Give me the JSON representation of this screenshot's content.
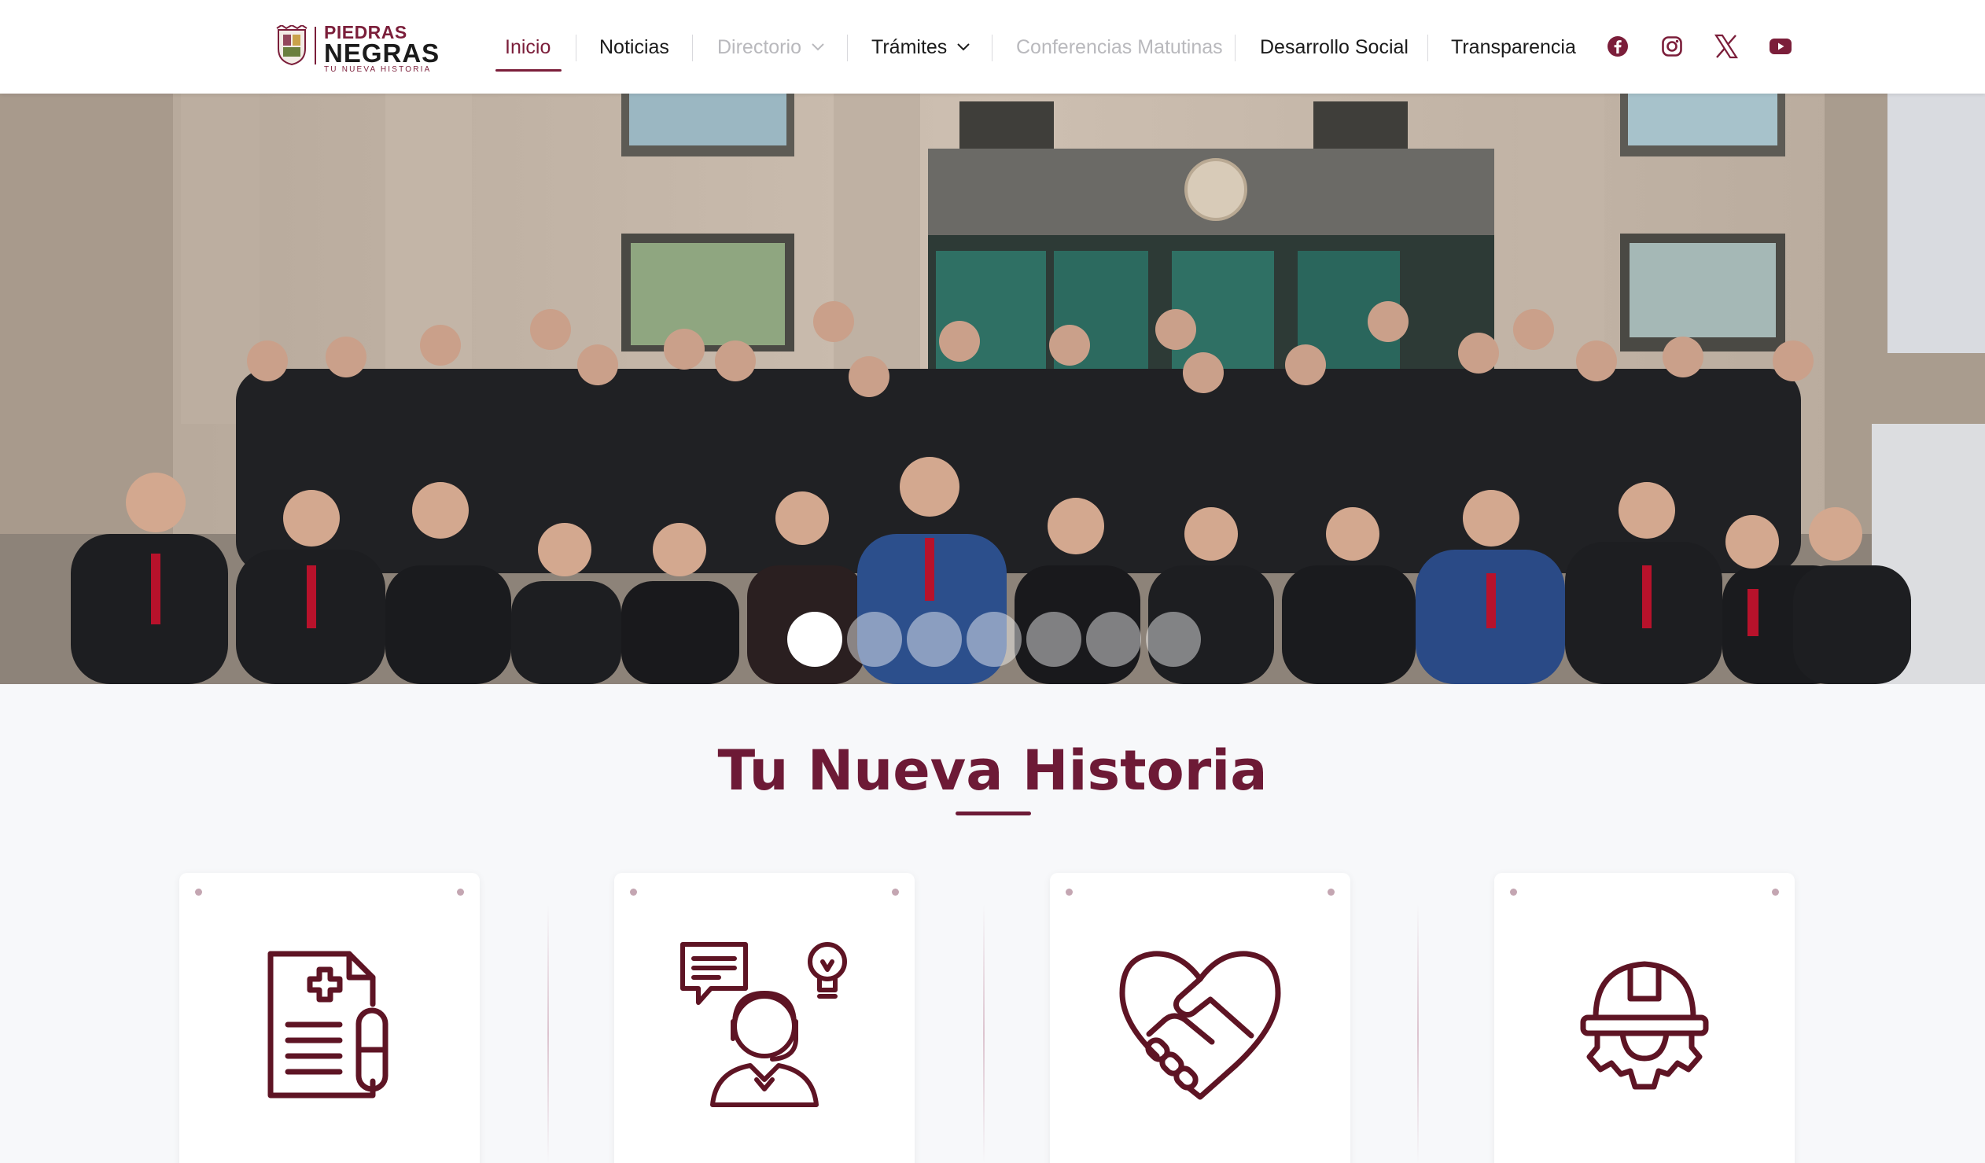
{
  "brand": {
    "line1": "PIEDRAS",
    "line2": "NEGRAS",
    "tagline": "TU NUEVA HISTORIA",
    "color": "#7b1e3a"
  },
  "nav": {
    "items": [
      {
        "label": "Inicio",
        "state": "active"
      },
      {
        "label": "Noticias",
        "state": "normal"
      },
      {
        "label": "Directorio",
        "state": "disabled",
        "dropdown": true
      },
      {
        "label": "Trámites",
        "state": "normal",
        "dropdown": true
      },
      {
        "label": "Conferencias Matutinas",
        "state": "disabled"
      },
      {
        "label": "Desarrollo Social",
        "state": "normal"
      },
      {
        "label": "Transparencia",
        "state": "normal"
      }
    ],
    "social": [
      "facebook-icon",
      "instagram-icon",
      "x-icon",
      "youtube-icon"
    ]
  },
  "hero": {
    "slides_total": 7,
    "active_slide": 1,
    "image": "group-photo"
  },
  "section": {
    "title": "Tu Nueva Historia"
  },
  "cards": [
    {
      "icon": "medical-document-icon"
    },
    {
      "icon": "customer-service-icon"
    },
    {
      "icon": "handshake-heart-icon"
    },
    {
      "icon": "worker-helmet-gear-icon"
    }
  ],
  "colors": {
    "accent": "#7b1e3a",
    "title": "#6d1a36",
    "icon_stroke": "#5e1424",
    "page_bg": "#f7f8fa"
  }
}
